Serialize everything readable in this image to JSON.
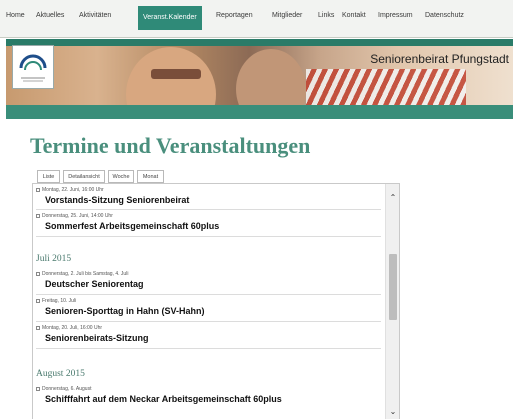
{
  "nav": {
    "items": [
      "Home",
      "Aktuelles",
      "Aktivitäten",
      "Veranst.Kalender",
      "Reportagen",
      "Mitglieder",
      "Links",
      "Kontakt",
      "Impressum",
      "Datenschutz"
    ],
    "active": "Veranst.Kalender"
  },
  "header": {
    "site_title": "Seniorenbeirat Pfungstadt"
  },
  "colors": {
    "accent": "#2f8a78",
    "title": "#4a8f7d"
  },
  "page": {
    "title": "Termine und Veranstaltungen"
  },
  "tabs": [
    "Liste",
    "Detailansicht",
    "Woche",
    "Monat"
  ],
  "events": [
    {
      "date": "Montag, 22. Juni, 16:00 Uhr",
      "title": "Vorstands-Sitzung Seniorenbeirat"
    },
    {
      "date": "Donnerstag, 25. Juni, 14:00 Uhr",
      "title": "Sommerfest Arbeitsgemeinschaft 60plus"
    },
    {
      "date": "Donnerstag, 2. Juli bis Samstag, 4. Juli",
      "title": "Deutscher Seniorentag"
    },
    {
      "date": "Freitag, 10. Juli",
      "title": "Senioren-Sporttag in Hahn (SV-Hahn)"
    },
    {
      "date": "Montag, 20. Juli, 16:00 Uhr",
      "title": "Seniorenbeirats-Sitzung"
    },
    {
      "date": "Donnerstag, 6. August",
      "title": "Schifffahrt auf dem Neckar Arbeitsgemeinschaft 60plus"
    }
  ],
  "months": [
    "Juli 2015",
    "August 2015"
  ],
  "icons": {
    "logo": "logo-icon",
    "scroll_up": "chevron-up-icon",
    "scroll_down": "chevron-down-icon",
    "event_toggle": "expand-box-icon"
  }
}
